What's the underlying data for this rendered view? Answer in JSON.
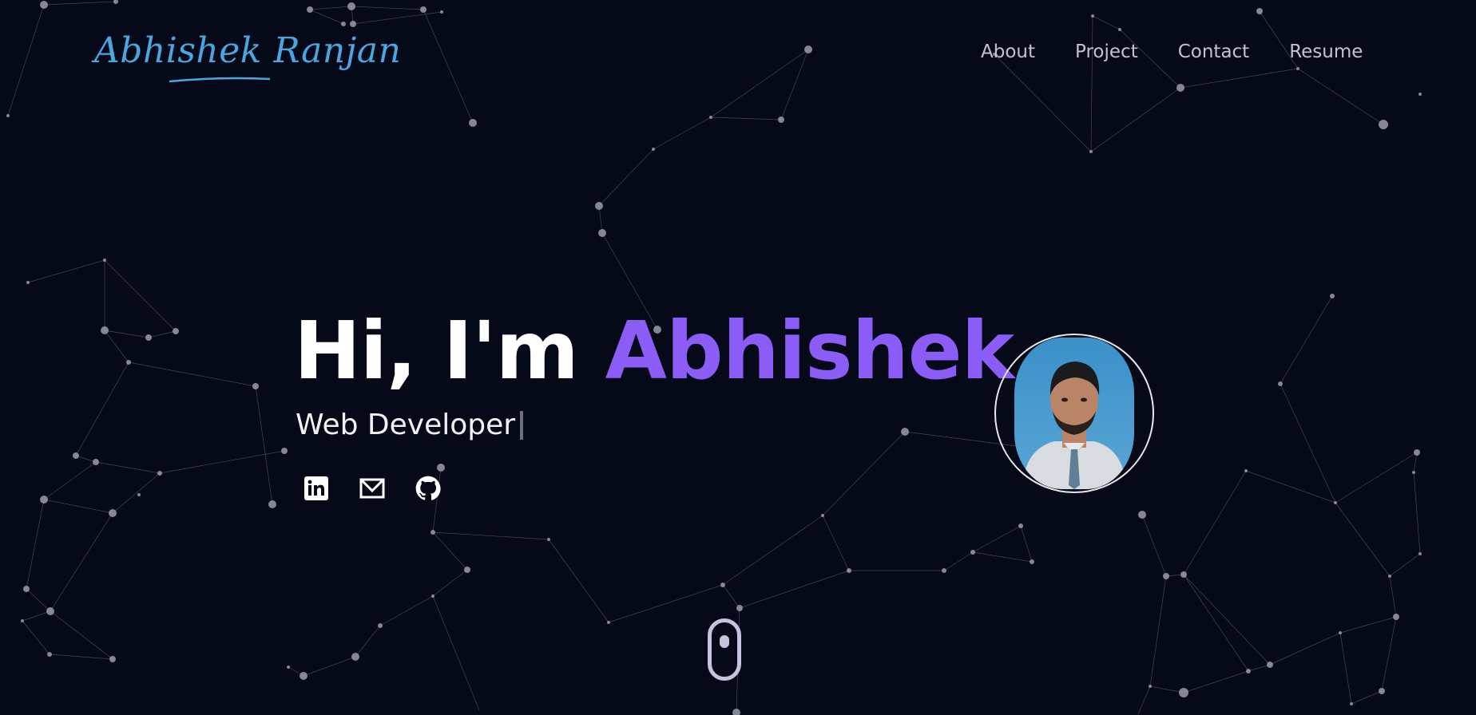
{
  "brand": {
    "logo_text": "Abhishek Ranjan",
    "accent": "#4aa6e0"
  },
  "nav": {
    "items": [
      {
        "label": "About"
      },
      {
        "label": "Project"
      },
      {
        "label": "Contact"
      },
      {
        "label": "Resume"
      }
    ]
  },
  "hero": {
    "greeting": "Hi, I'm",
    "name": "Abhishek",
    "name_color": "#8b5cf6",
    "role": "Web Developer"
  },
  "socials": [
    {
      "icon": "linkedin-icon"
    },
    {
      "icon": "mail-icon"
    },
    {
      "icon": "github-icon"
    }
  ],
  "scroll_indicator": {
    "icon": "mouse-scroll-icon"
  }
}
